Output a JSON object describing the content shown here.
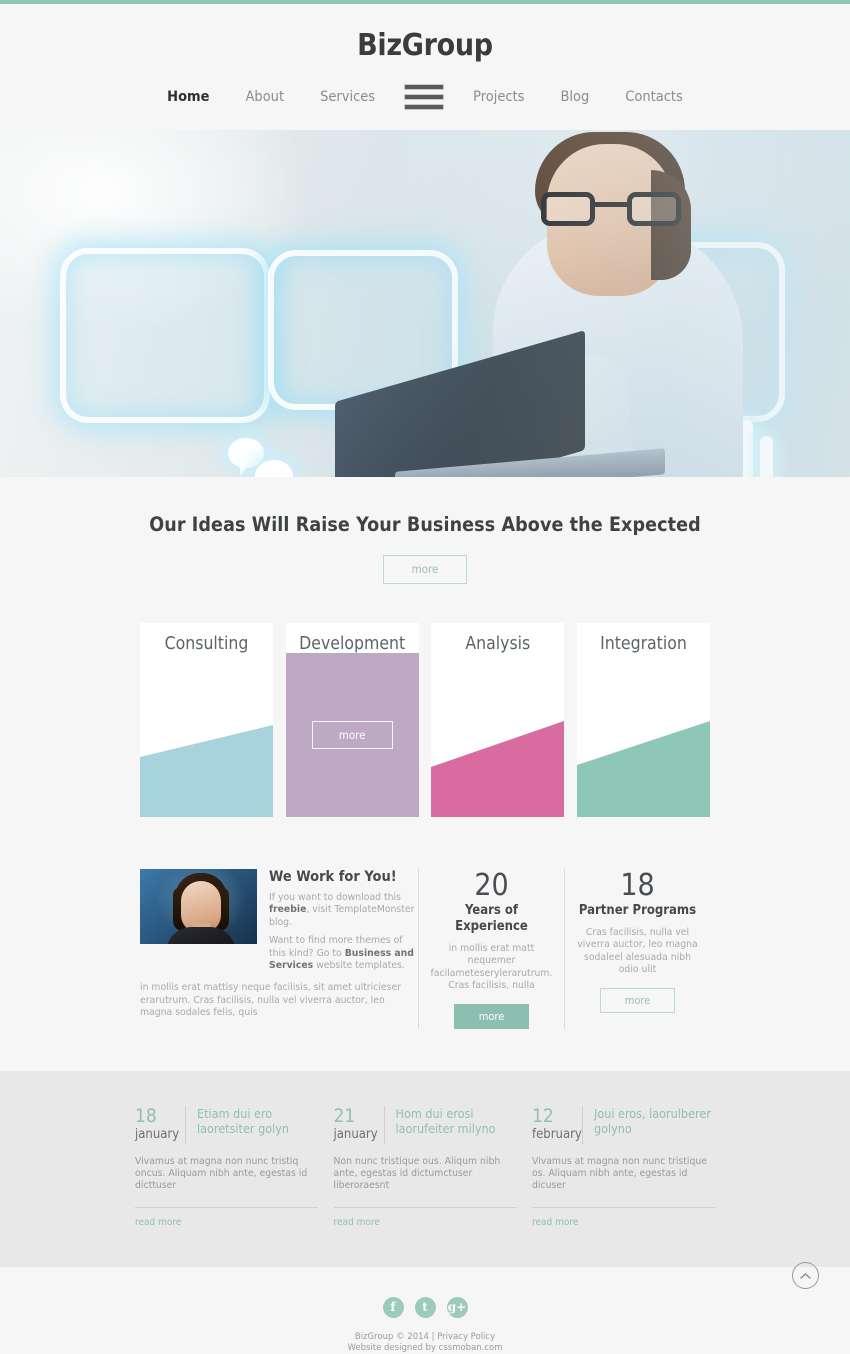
{
  "brand": "BizGroup",
  "nav": {
    "items": [
      {
        "label": "Home",
        "active": true
      },
      {
        "label": "About",
        "active": false
      },
      {
        "label": "Services",
        "active": false
      },
      {
        "label": "Projects",
        "active": false
      },
      {
        "label": "Blog",
        "active": false
      },
      {
        "label": "Contacts",
        "active": false
      }
    ],
    "menu_icon": "hamburger-icon"
  },
  "hero": {
    "alt": "man with glasses holding laptop with glowing holographic icons",
    "slides": [
      {
        "index": 1,
        "active": true
      },
      {
        "index": 2,
        "active": false
      },
      {
        "index": 3,
        "active": false
      }
    ]
  },
  "intro": {
    "heading": "Our Ideas Will Raise Your Business Above the Expected",
    "more_label": "more"
  },
  "cards": [
    {
      "title": "Consulting",
      "color": "#a8d3dd",
      "hover": false,
      "more_label": "more"
    },
    {
      "title": "Development",
      "color": "#bda9c4",
      "hover": true,
      "more_label": "more"
    },
    {
      "title": "Analysis",
      "color": "#d86ba0",
      "hover": false,
      "more_label": "more"
    },
    {
      "title": "Integration",
      "color": "#8ec6b8",
      "hover": false,
      "more_label": "more"
    }
  ],
  "work": {
    "heading": "We Work for You!",
    "para1_a": "If you want to download this ",
    "para1_b": "freebie",
    "para1_c": ", visit TemplateMonster blog.",
    "para2_a": "Want to find more themes of this kind? Go to ",
    "para2_b": "Business and Services",
    "para2_c": " website templates.",
    "para3": "in mollis erat mattisy neque facilisis, sit amet ultricieser erarutrum. Cras facilisis, nulla vel viverra auctor, leo magna sodales felis, quis",
    "portrait_alt": "businesswoman portrait"
  },
  "stats": [
    {
      "number": "20",
      "caption": "Years of Experience",
      "desc": "in mollis erat matt nequemer facilameteserylerarutrum. Cras facilisis, nulla",
      "more_label": "more",
      "filled": true
    },
    {
      "number": "18",
      "caption": "Partner Programs",
      "desc": "Cras facilisis, nulla vel viverra auctor, leo magna sodaleel alesuada nibh odio ulit",
      "more_label": "more",
      "filled": false
    }
  ],
  "news": [
    {
      "day": "18",
      "month": "january",
      "title": "Etiam dui ero laoretsiter golyn",
      "body": "Vivamus at magna non nunc tristiq oncus. Aliquam nibh ante, egestas id dicttuser",
      "read_more": "read more"
    },
    {
      "day": "21",
      "month": "january",
      "title": "Hom dui erosi laorufeiter milyno",
      "body": "Non nunc tristique ous. Aliqum nibh ante, egestas id dictumctuser liberoraesnt",
      "read_more": "read more"
    },
    {
      "day": "12",
      "month": "february",
      "title": "Joui eros, laorulberer golyno",
      "body": "Vivamus at magna non nunc tristique os. Aliquam nibh ante, egestas id dicuser",
      "read_more": "read more"
    }
  ],
  "footer": {
    "socials": [
      {
        "name": "facebook-icon",
        "glyph": "f"
      },
      {
        "name": "twitter-icon",
        "glyph": "t"
      },
      {
        "name": "googleplus-icon",
        "glyph": "g+"
      }
    ],
    "copy_line1": "BizGroup © 2014 | Privacy Policy",
    "copy_line2": "Website designed by cssmoban.com",
    "scroll_top_icon": "chevron-up-icon"
  },
  "colors": {
    "accent_teal": "#8ec6b8",
    "accent_teal_light": "#9ccbbe",
    "text_dark": "#3c3c3c",
    "text_muted": "#a9a9a9",
    "news_bg": "#e8e8e8",
    "page_bg": "#f6f6f6"
  }
}
